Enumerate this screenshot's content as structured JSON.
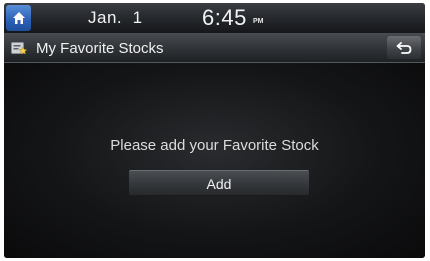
{
  "statusbar": {
    "date": "Jan.  1",
    "time": "6:45",
    "ampm": "PM"
  },
  "header": {
    "title": "My Favorite Stocks",
    "title_icon": "favorite-stocks-icon",
    "back_icon": "back-arrow-icon"
  },
  "main": {
    "message": "Please add your Favorite Stock",
    "add_label": "Add"
  },
  "colors": {
    "home_button": "#2e63b8",
    "background": "#0b0b0c",
    "text": "#f2f2f2"
  }
}
